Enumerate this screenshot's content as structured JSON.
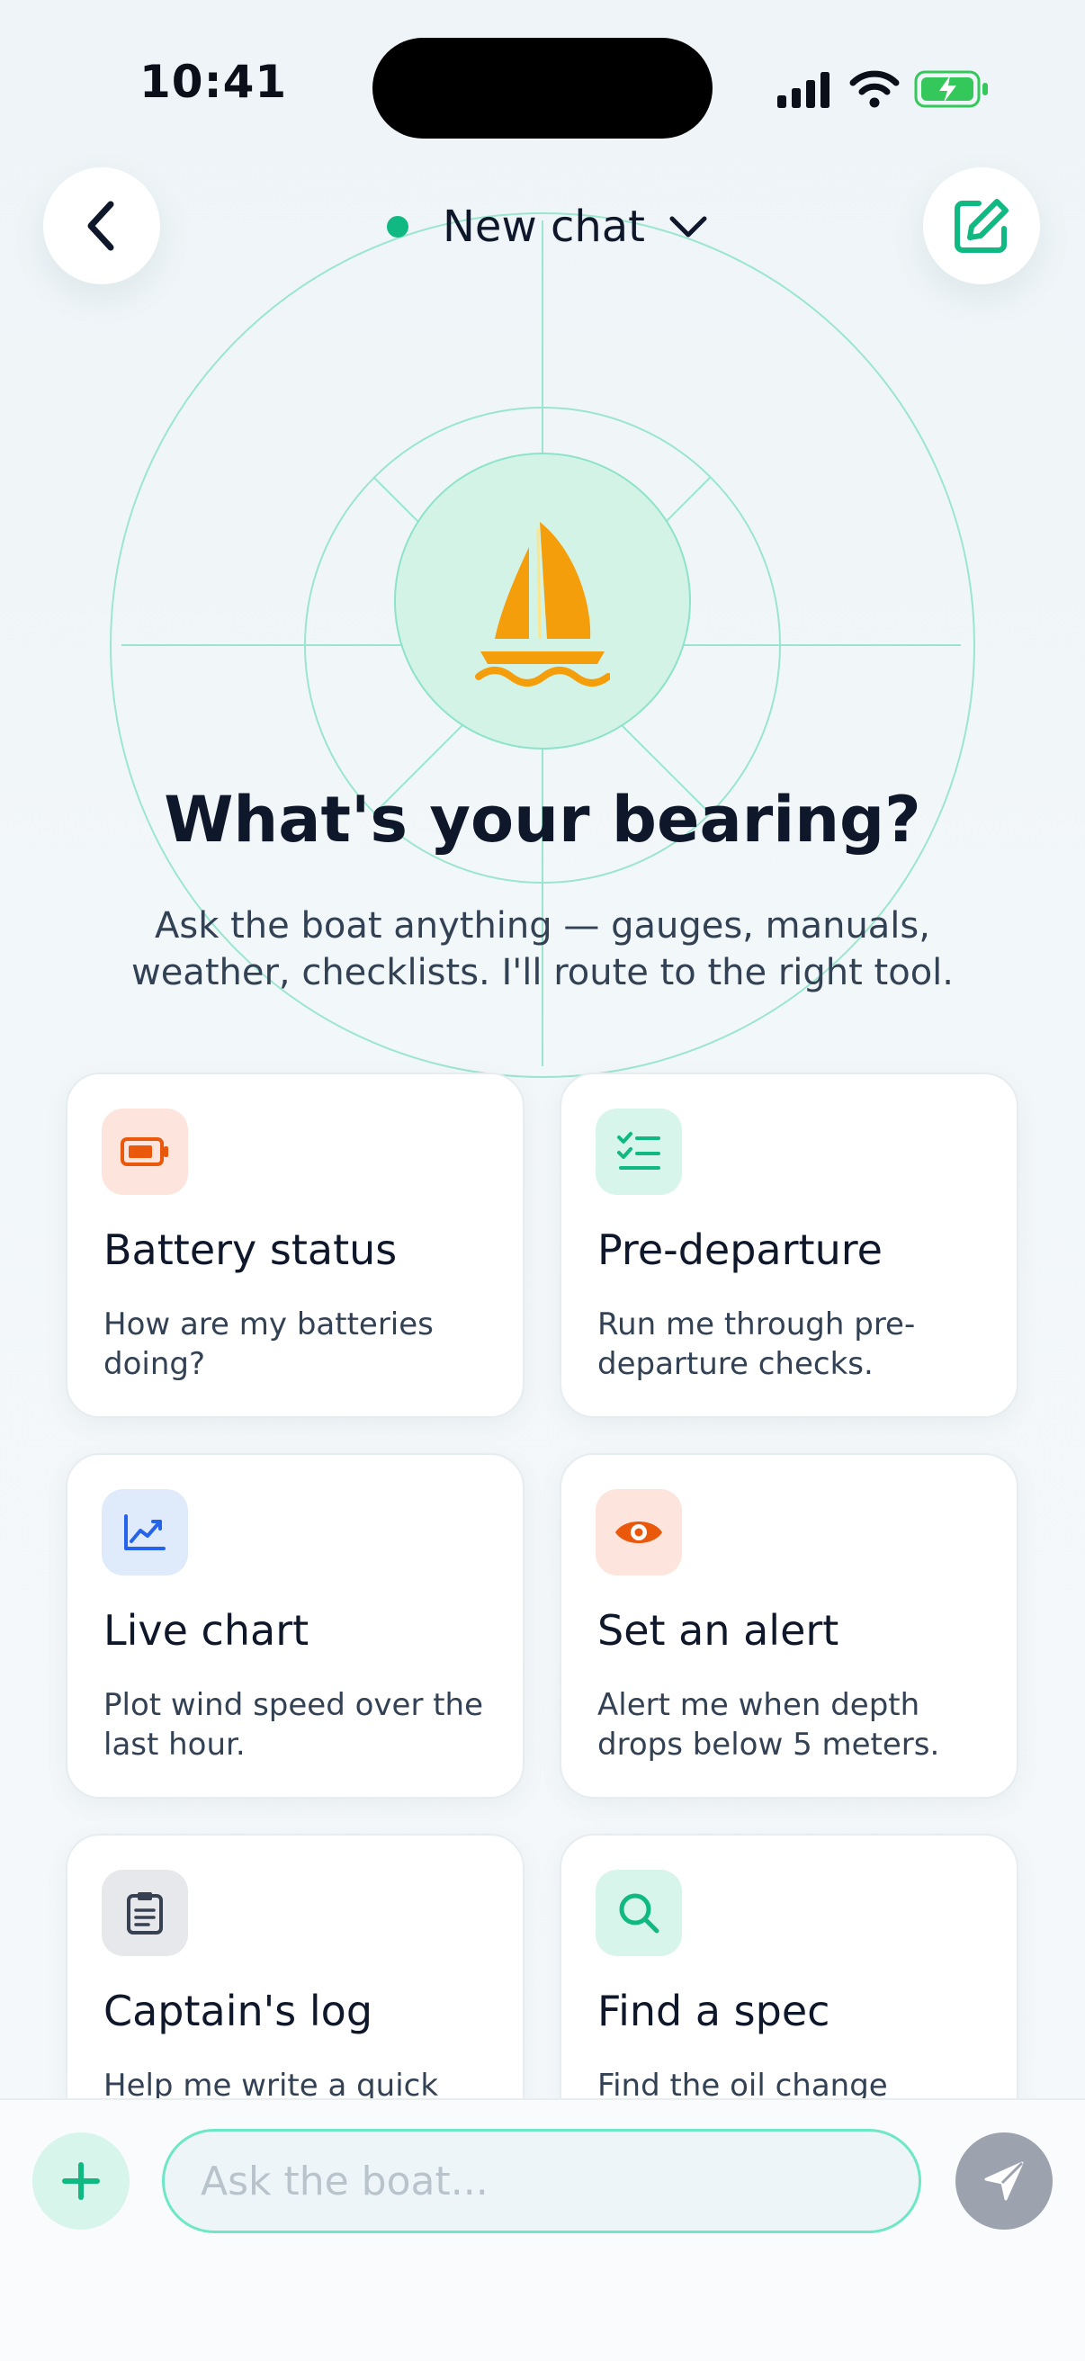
{
  "status_bar": {
    "time": "10:41",
    "icons": [
      "cellular-signal-icon",
      "wifi-icon",
      "battery-charging-icon"
    ],
    "battery_color": "#34c759"
  },
  "header": {
    "back_icon": "chevron-left-icon",
    "title": "New chat",
    "title_status": "online",
    "title_dropdown_icon": "chevron-down-icon",
    "new_chat_icon": "compose-icon"
  },
  "hero": {
    "icon": "sailboat-icon",
    "title": "What's your bearing?",
    "subtitle_line1": "Ask the boat anything — gauges, manuals,",
    "subtitle_line2": "weather, checklists. I'll route to the right tool."
  },
  "suggestions": [
    {
      "icon": "battery-icon",
      "title": "Battery status",
      "desc": "How are my batteries doing?"
    },
    {
      "icon": "checklist-icon",
      "title": "Pre-departure",
      "desc": "Run me through pre-departure checks."
    },
    {
      "icon": "line-chart-icon",
      "title": "Live chart",
      "desc": "Plot wind speed over the last hour."
    },
    {
      "icon": "eye-icon",
      "title": "Set an alert",
      "desc": "Alert me when depth drops below 5 meters."
    },
    {
      "icon": "clipboard-icon",
      "title": "Captain's log",
      "desc": "Help me write a quick"
    },
    {
      "icon": "search-icon",
      "title": "Find a spec",
      "desc": "Find the oil change"
    }
  ],
  "composer": {
    "add_icon": "plus-icon",
    "placeholder": "Ask the boat...",
    "value": "",
    "send_icon": "send-icon"
  },
  "colors": {
    "accent": "#10b981",
    "brand_orange": "#f59e0b",
    "text_primary": "#0f172a"
  }
}
